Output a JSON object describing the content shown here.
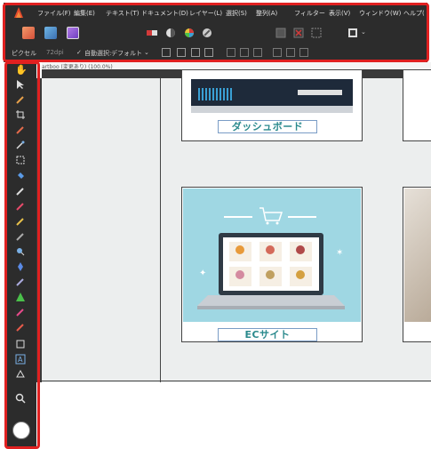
{
  "menu": {
    "items": [
      "ファイル(F)",
      "編集(E)",
      "テキスト(T)",
      "ドキュメント(D)",
      "レイヤー(L)",
      "選択(S)",
      "整列(A)",
      "フィルター",
      "表示(V)",
      "ウィンドウ(W)",
      "ヘルプ("
    ]
  },
  "context_bar": {
    "unit_label": "ピクセル",
    "dpi_value": "72dpi",
    "auto_select_label": "自動選択:",
    "auto_select_value": "デフォルト"
  },
  "document": {
    "tab_title": "artboo (変更あり) (100.0%)"
  },
  "cards": {
    "dashboard_label": "ダッシュボード",
    "ec_label": "ECサイト"
  },
  "colors": {
    "app_bg": "#2c2c2c",
    "highlight": "#e02020",
    "label_teal": "#2b8a8d",
    "canvas_bg": "#eceeee"
  },
  "icons": {
    "toolbar": [
      "persona-photo-icon",
      "persona-pixel-icon",
      "persona-export-icon",
      "gradient-icon",
      "contrast-icon",
      "color-wheel-icon",
      "brush-settings-icon",
      "snap-icon",
      "delete-icon",
      "frame-icon",
      "arrange-icon"
    ],
    "tools": [
      "hand-icon",
      "move-icon",
      "color-picker-icon",
      "crop-icon",
      "selection-brush-icon",
      "magic-wand-icon",
      "marquee-icon",
      "flood-fill-icon",
      "paint-brush-icon",
      "clone-icon",
      "healing-icon",
      "dodge-icon",
      "smudge-icon",
      "blur-icon",
      "pen-icon",
      "shape-icon",
      "text-icon",
      "frame-text-icon",
      "zoom-icon",
      "color-swatch-icon"
    ]
  }
}
